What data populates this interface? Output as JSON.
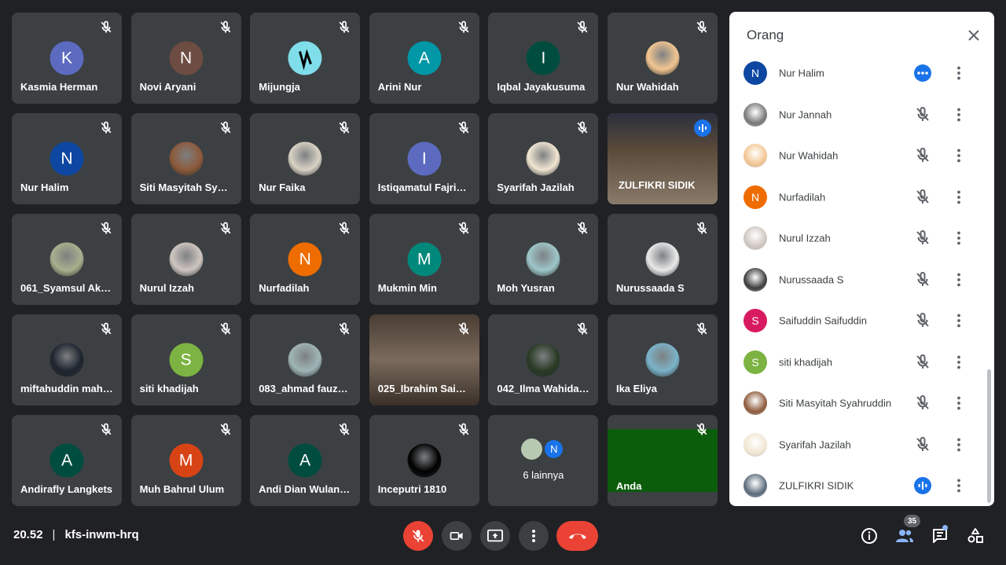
{
  "tiles": [
    {
      "name": "Kasmia Herman",
      "initial": "K",
      "color": "#5c6bc0",
      "kind": "letter"
    },
    {
      "name": "Novi Aryani",
      "initial": "N",
      "color": "#6d4c41",
      "kind": "letter"
    },
    {
      "name": "Mijungja",
      "initial": "",
      "color": "#80deea",
      "kind": "photo-logo"
    },
    {
      "name": "Arini Nur",
      "initial": "A",
      "color": "#0097a7",
      "kind": "letter"
    },
    {
      "name": "Iqbal Jayakusuma",
      "initial": "I",
      "color": "#004d40",
      "kind": "letter"
    },
    {
      "name": "Nur Wahidah",
      "initial": "",
      "color": "#f2c691",
      "kind": "photo"
    },
    {
      "name": "Nur Halim",
      "initial": "N",
      "color": "#0d47a1",
      "kind": "letter"
    },
    {
      "name": "Siti Masyitah Sya…",
      "initial": "",
      "color": "#8d5a3b",
      "kind": "photo"
    },
    {
      "name": "Nur Faika",
      "initial": "",
      "color": "#d9d2c5",
      "kind": "photo"
    },
    {
      "name": "Istiqamatul Fajriy…",
      "initial": "I",
      "color": "#5c6bc0",
      "kind": "letter"
    },
    {
      "name": "Syarifah Jazilah",
      "initial": "",
      "color": "#f1e6d2",
      "kind": "photo"
    },
    {
      "name": "ZULFIKRI SIDIK",
      "initial": "",
      "color": "#3a3f52",
      "kind": "video"
    },
    {
      "name": "061_Syamsul Akb…",
      "initial": "",
      "color": "#a7b08d",
      "kind": "photo"
    },
    {
      "name": "Nurul Izzah",
      "initial": "",
      "color": "#cfc6c0",
      "kind": "photo"
    },
    {
      "name": "Nurfadilah",
      "initial": "N",
      "color": "#ef6c00",
      "kind": "letter"
    },
    {
      "name": "Mukmin Min",
      "initial": "M",
      "color": "#00897b",
      "kind": "letter"
    },
    {
      "name": "Moh Yusran",
      "initial": "",
      "color": "#9ec7c9",
      "kind": "photo"
    },
    {
      "name": "Nurussaada S",
      "initial": "",
      "color": "#e9e9e9",
      "kind": "photo"
    },
    {
      "name": "miftahuddin mah…",
      "initial": "",
      "color": "#1e2530",
      "kind": "photo"
    },
    {
      "name": "siti khadijah",
      "initial": "S",
      "color": "#7cb342",
      "kind": "letter"
    },
    {
      "name": "083_ahmad fauz…",
      "initial": "",
      "color": "#9fb5b6",
      "kind": "photo"
    },
    {
      "name": "025_Ibrahim Sai…",
      "initial": "",
      "color": "#5e4a3d",
      "kind": "video"
    },
    {
      "name": "042_Ilma Wahida…",
      "initial": "",
      "color": "#2a3b26",
      "kind": "photo"
    },
    {
      "name": "Ika Eliya",
      "initial": "",
      "color": "#7bb3c9",
      "kind": "photo"
    },
    {
      "name": "Andirafly Langkets",
      "initial": "A",
      "color": "#004d40",
      "kind": "letter"
    },
    {
      "name": "Muh Bahrul Ulum",
      "initial": "M",
      "color": "#d84315",
      "kind": "letter"
    },
    {
      "name": "Andi Dian Wulan…",
      "initial": "A",
      "color": "#004d40",
      "kind": "letter"
    },
    {
      "name": "Inceputri 1810",
      "initial": "",
      "color": "#000000",
      "kind": "photo"
    },
    {
      "name": "6 lainnya",
      "initial": "N",
      "color": "#1a73e8",
      "kind": "others"
    },
    {
      "name": "Anda",
      "initial": "",
      "color": "#0b5c0b",
      "kind": "self"
    }
  ],
  "panel": {
    "title": "Orang",
    "people": [
      {
        "name": "Nur Halim",
        "initial": "N",
        "color": "#0d47a1",
        "status": "more"
      },
      {
        "name": "Nur Jannah",
        "initial": "",
        "color": "#777777",
        "status": "muted"
      },
      {
        "name": "Nur Wahidah",
        "initial": "",
        "color": "#f2c691",
        "status": "muted"
      },
      {
        "name": "Nurfadilah",
        "initial": "N",
        "color": "#ef6c00",
        "status": "muted"
      },
      {
        "name": "Nurul Izzah",
        "initial": "",
        "color": "#cfc6c0",
        "status": "muted"
      },
      {
        "name": "Nurussaada S",
        "initial": "",
        "color": "#3b3b3b",
        "status": "muted"
      },
      {
        "name": "Saifuddin Saifuddin",
        "initial": "S",
        "color": "#d81b60",
        "status": "muted"
      },
      {
        "name": "siti khadijah",
        "initial": "S",
        "color": "#7cb342",
        "status": "muted"
      },
      {
        "name": "Siti Masyitah Syahruddin",
        "initial": "",
        "color": "#8d5a3b",
        "status": "muted"
      },
      {
        "name": "Syarifah Jazilah",
        "initial": "",
        "color": "#f1e6d2",
        "status": "muted"
      },
      {
        "name": "ZULFIKRI SIDIK",
        "initial": "",
        "color": "#5a6a7a",
        "status": "speaking"
      }
    ]
  },
  "footer": {
    "time": "20.52",
    "separator": "|",
    "meeting_code": "kfs-inwm-hrq",
    "participant_count": "35"
  }
}
